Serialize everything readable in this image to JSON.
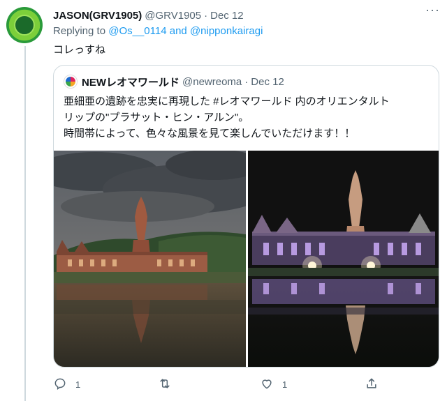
{
  "tweet": {
    "display_name": "JASON(GRV1905)",
    "handle": "@GRV1905",
    "separator": "·",
    "date": "Dec 12",
    "more": "···",
    "replying_prefix": "Replying to",
    "replying_user1": "@Os__0114",
    "replying_and": "and",
    "replying_user2": "@nipponkairagi",
    "text": "コレっすね"
  },
  "quote": {
    "display_name": "NEWレオマワールド",
    "handle": "@newreoma",
    "separator": "·",
    "date": "Dec 12",
    "text_lines": [
      "亜細亜の遺跡を忠実に再現した #レオマワールド 内のオリエンタルト",
      "リップの\"プラサット・ヒン・アルン\"。",
      "時間帯によって、色々な風景を見て楽しんでいただけます！！"
    ]
  },
  "actions": {
    "reply_icon": "reply-icon",
    "reply_count": "1",
    "retweet_icon": "retweet-icon",
    "retweet_count": "",
    "like_icon": "heart-icon",
    "like_count": "1",
    "share_icon": "share-icon"
  },
  "colors": {
    "link": "#1d9bf0",
    "secondary_text": "#536471",
    "border": "#cfd9de"
  }
}
